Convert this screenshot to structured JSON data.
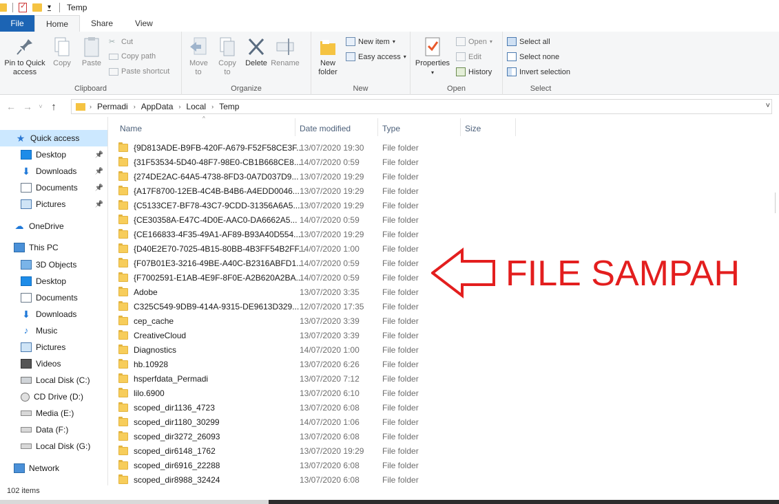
{
  "window": {
    "title": "Temp"
  },
  "ribbon_tabs": [
    {
      "label": "File"
    },
    {
      "label": "Home"
    },
    {
      "label": "Share"
    },
    {
      "label": "View"
    }
  ],
  "ribbon": {
    "clipboard": {
      "label": "Clipboard",
      "pin": "Pin to Quick access",
      "copy": "Copy",
      "paste": "Paste",
      "cut": "Cut",
      "copy_path": "Copy path",
      "paste_shortcut": "Paste shortcut"
    },
    "organize": {
      "label": "Organize",
      "move_to": "Move to",
      "copy_to": "Copy to",
      "delete": "Delete",
      "rename": "Rename"
    },
    "new": {
      "label": "New",
      "new_folder": "New folder",
      "new_item": "New item",
      "easy_access": "Easy access"
    },
    "open": {
      "label": "Open",
      "properties": "Properties",
      "open": "Open",
      "edit": "Edit",
      "history": "History"
    },
    "select": {
      "label": "Select",
      "select_all": "Select all",
      "select_none": "Select none",
      "invert": "Invert selection"
    }
  },
  "address": {
    "crumbs": [
      "Permadi",
      "AppData",
      "Local",
      "Temp"
    ]
  },
  "sidebar": [
    {
      "label": "Quick access",
      "icon": "star-icon",
      "selected": true
    },
    {
      "label": "Desktop",
      "icon": "desktop-icon",
      "pinned": true
    },
    {
      "label": "Downloads",
      "icon": "download-icon",
      "pinned": true
    },
    {
      "label": "Documents",
      "icon": "documents-icon",
      "pinned": true
    },
    {
      "label": "Pictures",
      "icon": "pictures-icon",
      "pinned": true
    },
    {
      "label": "OneDrive",
      "icon": "cloud-icon"
    },
    {
      "label": "This PC",
      "icon": "computer-icon"
    },
    {
      "label": "3D Objects",
      "icon": "cube-icon"
    },
    {
      "label": "Desktop",
      "icon": "desktop-icon"
    },
    {
      "label": "Documents",
      "icon": "documents-icon"
    },
    {
      "label": "Downloads",
      "icon": "download-icon"
    },
    {
      "label": "Music",
      "icon": "music-icon"
    },
    {
      "label": "Pictures",
      "icon": "pictures-icon"
    },
    {
      "label": "Videos",
      "icon": "video-icon"
    },
    {
      "label": "Local Disk (C:)",
      "icon": "disk-icon"
    },
    {
      "label": "CD Drive (D:)",
      "icon": "cd-icon"
    },
    {
      "label": "Media (E:)",
      "icon": "drive-icon"
    },
    {
      "label": "Data (F:)",
      "icon": "drive-icon"
    },
    {
      "label": "Local Disk (G:)",
      "icon": "drive-icon"
    },
    {
      "label": "Network",
      "icon": "network-icon"
    }
  ],
  "columns": {
    "name": "Name",
    "date": "Date modified",
    "type": "Type",
    "size": "Size"
  },
  "files": [
    {
      "name": "{9D813ADE-B9FB-420F-A679-F52F58CE3F...",
      "date": "13/07/2020 19:30",
      "type": "File folder"
    },
    {
      "name": "{31F53534-5D40-48F7-98E0-CB1B668CE8...",
      "date": "14/07/2020 0:59",
      "type": "File folder"
    },
    {
      "name": "{274DE2AC-64A5-4738-8FD3-0A7D037D9...",
      "date": "13/07/2020 19:29",
      "type": "File folder"
    },
    {
      "name": "{A17F8700-12EB-4C4B-B4B6-A4EDD0046...",
      "date": "13/07/2020 19:29",
      "type": "File folder"
    },
    {
      "name": "{C5133CE7-BF78-43C7-9CDD-31356A6A5...",
      "date": "13/07/2020 19:29",
      "type": "File folder"
    },
    {
      "name": "{CE30358A-E47C-4D0E-AAC0-DA6662A5...",
      "date": "14/07/2020 0:59",
      "type": "File folder"
    },
    {
      "name": "{CE166833-4F35-49A1-AF89-B93A40D554...",
      "date": "13/07/2020 19:29",
      "type": "File folder"
    },
    {
      "name": "{D40E2E70-7025-4B15-80BB-4B3FF54B2FF...",
      "date": "14/07/2020 1:00",
      "type": "File folder"
    },
    {
      "name": "{F07B01E3-3216-49BE-A40C-B2316ABFD1...",
      "date": "14/07/2020 0:59",
      "type": "File folder"
    },
    {
      "name": "{F7002591-E1AB-4E9F-8F0E-A2B620A2BA...",
      "date": "14/07/2020 0:59",
      "type": "File folder"
    },
    {
      "name": "Adobe",
      "date": "13/07/2020 3:35",
      "type": "File folder"
    },
    {
      "name": "C325C549-9DB9-414A-9315-DE9613D329...",
      "date": "12/07/2020 17:35",
      "type": "File folder"
    },
    {
      "name": "cep_cache",
      "date": "13/07/2020 3:39",
      "type": "File folder"
    },
    {
      "name": "CreativeCloud",
      "date": "13/07/2020 3:39",
      "type": "File folder"
    },
    {
      "name": "Diagnostics",
      "date": "14/07/2020 1:00",
      "type": "File folder"
    },
    {
      "name": "hb.10928",
      "date": "13/07/2020 6:26",
      "type": "File folder"
    },
    {
      "name": "hsperfdata_Permadi",
      "date": "13/07/2020 7:12",
      "type": "File folder"
    },
    {
      "name": "lilo.6900",
      "date": "13/07/2020 6:10",
      "type": "File folder"
    },
    {
      "name": "scoped_dir1136_4723",
      "date": "13/07/2020 6:08",
      "type": "File folder"
    },
    {
      "name": "scoped_dir1180_30299",
      "date": "14/07/2020 1:06",
      "type": "File folder"
    },
    {
      "name": "scoped_dir3272_26093",
      "date": "13/07/2020 6:08",
      "type": "File folder"
    },
    {
      "name": "scoped_dir6148_1762",
      "date": "13/07/2020 19:29",
      "type": "File folder"
    },
    {
      "name": "scoped_dir6916_22288",
      "date": "13/07/2020 6:08",
      "type": "File folder"
    },
    {
      "name": "scoped_dir8988_32424",
      "date": "13/07/2020 6:08",
      "type": "File folder"
    }
  ],
  "annotation": {
    "text": "FILE SAMPAH",
    "color": "#e31e1e"
  },
  "status": {
    "items": "102 items"
  }
}
